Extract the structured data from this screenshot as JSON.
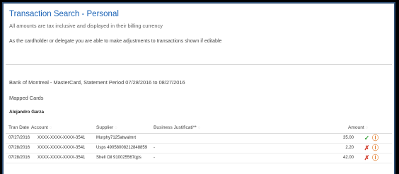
{
  "page": {
    "title": "Transaction Search - Personal",
    "subtitle": "All amounts are tax inclusive and displayed in their billing currency",
    "notice": "As the cardholder or delegate you are able to make adjustments to transactions shown if editable"
  },
  "statement": {
    "bank_line": "Bank of Montreal - MasterCard, Statement Period 07/28/2016 to 08/27/2016",
    "mapped_cards": "Mapped Cards",
    "cardholder": "Alejandro Garza"
  },
  "table": {
    "headers": {
      "tran_date": "Tran Date",
      "account": "Account",
      "supplier": "Supplier",
      "business_just": "Business Justificati**",
      "amount": "Amount"
    },
    "rows": [
      {
        "date": "07/27/2016",
        "account": "XXXX-XXXX-XXXX-3541",
        "supplier": "Murphy7125atwalmrt",
        "justification": "",
        "amount": "35.00",
        "status_icon": "check-icon"
      },
      {
        "date": "07/28/2016",
        "account": "XXXX-XXXX-XXXX-3541",
        "supplier": "Usps 49058008212848859",
        "justification": "-",
        "amount": "2.20",
        "status_icon": "x-icon"
      },
      {
        "date": "07/28/2016",
        "account": "XXXX-XXXX-XXXX-3541",
        "supplier": "Shell Oil 910025567qps",
        "justification": "-",
        "amount": "42.00",
        "status_icon": "x-icon"
      }
    ]
  },
  "colors": {
    "title": "#1a63b6",
    "check": "#37a13a",
    "x": "#d23a2a",
    "history": "#e07b28"
  }
}
